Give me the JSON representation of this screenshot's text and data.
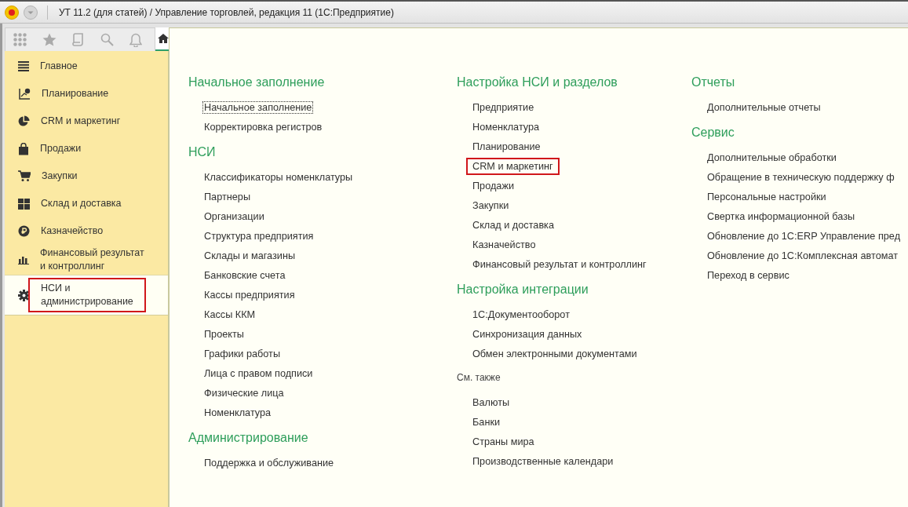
{
  "window": {
    "title": "УТ 11.2 (для статей) / Управление торговлей, редакция 11  (1С:Предприятие)"
  },
  "sidebar": {
    "items": [
      {
        "label": "Главное",
        "selected": false,
        "highlighted": false
      },
      {
        "label": "Планирование",
        "selected": false,
        "highlighted": false
      },
      {
        "label": "CRM и маркетинг",
        "selected": false,
        "highlighted": false
      },
      {
        "label": "Продажи",
        "selected": false,
        "highlighted": false
      },
      {
        "label": "Закупки",
        "selected": false,
        "highlighted": false
      },
      {
        "label": "Склад и доставка",
        "selected": false,
        "highlighted": false
      },
      {
        "label": "Казначейство",
        "selected": false,
        "highlighted": false
      },
      {
        "label": "Финансовый результат и контроллинг",
        "selected": false,
        "highlighted": false
      },
      {
        "label": "НСИ и администрирование",
        "selected": true,
        "highlighted": true
      }
    ]
  },
  "columns": [
    [
      {
        "kind": "heading",
        "title": "Начальное заполнение",
        "items": [
          {
            "label": "Начальное заполнение",
            "selected": true,
            "highlighted": false
          },
          {
            "label": "Корректировка регистров",
            "selected": false,
            "highlighted": false
          }
        ]
      },
      {
        "kind": "heading",
        "title": "НСИ",
        "items": [
          {
            "label": "Классификаторы номенклатуры",
            "selected": false,
            "highlighted": false
          },
          {
            "label": "Партнеры",
            "selected": false,
            "highlighted": false
          },
          {
            "label": "Организации",
            "selected": false,
            "highlighted": false
          },
          {
            "label": "Структура предприятия",
            "selected": false,
            "highlighted": false
          },
          {
            "label": "Склады и магазины",
            "selected": false,
            "highlighted": false
          },
          {
            "label": "Банковские счета",
            "selected": false,
            "highlighted": false
          },
          {
            "label": "Кассы предприятия",
            "selected": false,
            "highlighted": false
          },
          {
            "label": "Кассы ККМ",
            "selected": false,
            "highlighted": false
          },
          {
            "label": "Проекты",
            "selected": false,
            "highlighted": false
          },
          {
            "label": "Графики работы",
            "selected": false,
            "highlighted": false
          },
          {
            "label": "Лица с правом подписи",
            "selected": false,
            "highlighted": false
          },
          {
            "label": "Физические лица",
            "selected": false,
            "highlighted": false
          },
          {
            "label": "Номенклатура",
            "selected": false,
            "highlighted": false
          }
        ]
      },
      {
        "kind": "heading",
        "title": "Администрирование",
        "items": [
          {
            "label": "Поддержка и обслуживание",
            "selected": false,
            "highlighted": false
          }
        ]
      }
    ],
    [
      {
        "kind": "heading",
        "title": "Настройка НСИ и разделов",
        "items": [
          {
            "label": "Предприятие",
            "selected": false,
            "highlighted": false
          },
          {
            "label": "Номенклатура",
            "selected": false,
            "highlighted": false
          },
          {
            "label": "Планирование",
            "selected": false,
            "highlighted": false
          },
          {
            "label": "CRM и маркетинг",
            "selected": false,
            "highlighted": true
          },
          {
            "label": "Продажи",
            "selected": false,
            "highlighted": false
          },
          {
            "label": "Закупки",
            "selected": false,
            "highlighted": false
          },
          {
            "label": "Склад и доставка",
            "selected": false,
            "highlighted": false
          },
          {
            "label": "Казначейство",
            "selected": false,
            "highlighted": false
          },
          {
            "label": "Финансовый результат и контроллинг",
            "selected": false,
            "highlighted": false
          }
        ]
      },
      {
        "kind": "heading",
        "title": "Настройка интеграции",
        "items": [
          {
            "label": "1С:Документооборот",
            "selected": false,
            "highlighted": false
          },
          {
            "label": "Синхронизация данных",
            "selected": false,
            "highlighted": false
          },
          {
            "label": "Обмен электронными документами",
            "selected": false,
            "highlighted": false
          }
        ]
      },
      {
        "kind": "see_also",
        "title": "См. также",
        "items": [
          {
            "label": "Валюты",
            "selected": false,
            "highlighted": false
          },
          {
            "label": "Банки",
            "selected": false,
            "highlighted": false
          },
          {
            "label": "Страны мира",
            "selected": false,
            "highlighted": false
          },
          {
            "label": "Производственные календари",
            "selected": false,
            "highlighted": false
          }
        ]
      }
    ],
    [
      {
        "kind": "heading",
        "title": "Отчеты",
        "items": [
          {
            "label": "Дополнительные отчеты",
            "selected": false,
            "highlighted": false
          }
        ]
      },
      {
        "kind": "heading",
        "title": "Сервис",
        "items": [
          {
            "label": "Дополнительные обработки",
            "selected": false,
            "highlighted": false
          },
          {
            "label": "Обращение в техническую поддержку ф",
            "selected": false,
            "highlighted": false
          },
          {
            "label": "Персональные настройки",
            "selected": false,
            "highlighted": false
          },
          {
            "label": "Свертка информационной базы",
            "selected": false,
            "highlighted": false
          },
          {
            "label": "Обновление до 1С:ERP Управление пред",
            "selected": false,
            "highlighted": false
          },
          {
            "label": "Обновление до 1С:Комплексная автомат",
            "selected": false,
            "highlighted": false
          },
          {
            "label": "Переход в сервис",
            "selected": false,
            "highlighted": false
          }
        ]
      }
    ]
  ]
}
